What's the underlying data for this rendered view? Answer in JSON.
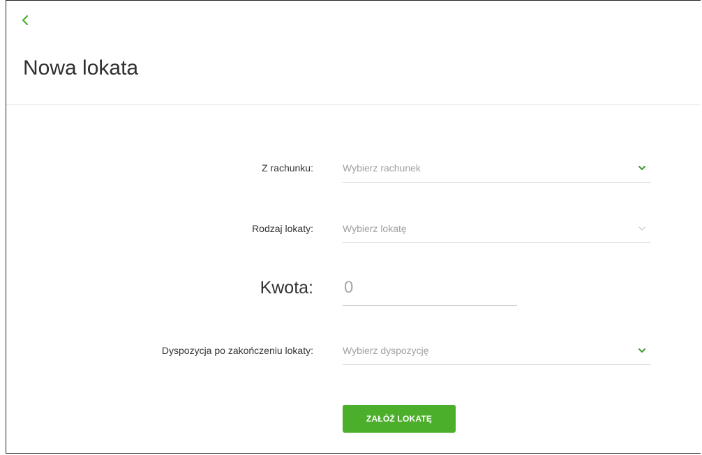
{
  "header": {
    "title": "Nowa lokata",
    "back_icon": "chevron-left-icon"
  },
  "form": {
    "account": {
      "label": "Z rachunku:",
      "placeholder": "Wybierz rachunek"
    },
    "deposit_type": {
      "label": "Rodzaj lokaty:",
      "placeholder": "Wybierz lokatę"
    },
    "amount": {
      "label": "Kwota:",
      "value": "0"
    },
    "disposition": {
      "label": "Dyspozycja po zakończeniu lokaty:",
      "placeholder": "Wybierz dyspozycję"
    },
    "submit_label": "ZAŁÓŻ LOKATĘ"
  },
  "colors": {
    "accent": "#4caf2b",
    "chevron_active": "#3c9a2a",
    "chevron_disabled": "#d0d0d0"
  }
}
